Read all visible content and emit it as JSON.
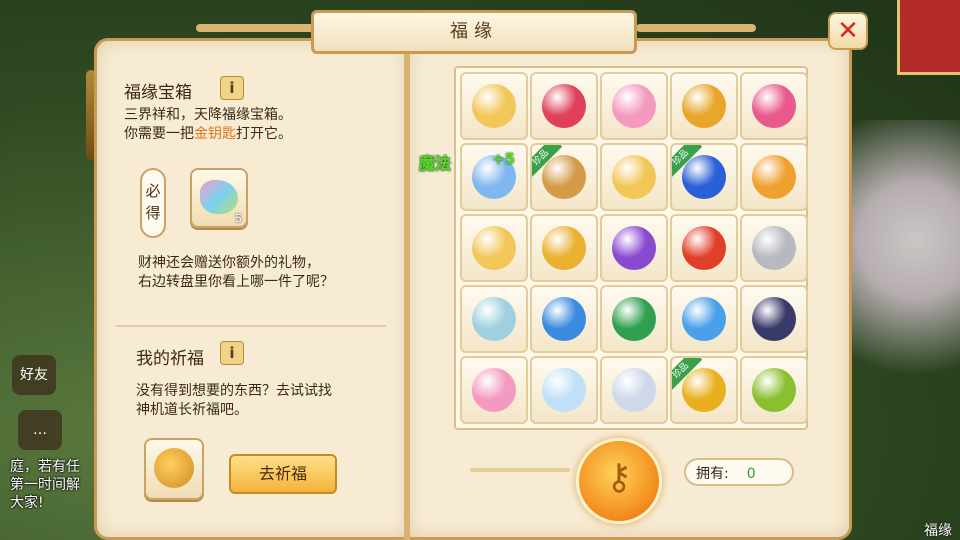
{
  "window": {
    "title": "福缘"
  },
  "left": {
    "chest_title": "福缘宝箱",
    "info_symbol": "i",
    "chest_desc_1": "三界祥和，天降福缘宝箱。",
    "chest_desc_2a": "你需要一把",
    "chest_desc_2b": "金钥匙",
    "chest_desc_2c": "打开它。",
    "must_label": "必得",
    "must_item_count": "5",
    "extra_desc_1": "财神还会赠送你额外的礼物，",
    "extra_desc_2": "右边转盘里你看上哪一件了呢？",
    "pray_title": "我的祈福",
    "pray_desc_1": "没有得到想要的东西？去试试找",
    "pray_desc_2": "神机道长祈福吧。",
    "pray_button": "去祈福"
  },
  "grid": {
    "rare_badge": "珍品",
    "magic_label": "魔法",
    "magic_bonus": "+5",
    "items": [
      {
        "name": "cheese-icon",
        "color": "#f2c75a"
      },
      {
        "name": "red-orb-icon",
        "color": "#e0405a"
      },
      {
        "name": "pink-pet-icon",
        "color": "#f49ac0"
      },
      {
        "name": "gold-coin-icon",
        "color": "#e8a62a"
      },
      {
        "name": "pink-orb-icon",
        "color": "#e85a8a"
      },
      {
        "name": "magic-orb-icon",
        "color": "#7fb8f0"
      },
      {
        "name": "scroll-icon",
        "color": "#d49a48"
      },
      {
        "name": "cheese-icon",
        "color": "#f2c75a"
      },
      {
        "name": "blue-orb-icon",
        "color": "#2a5fd6"
      },
      {
        "name": "fire-emblem-icon",
        "color": "#f0a030"
      },
      {
        "name": "cheese-icon",
        "color": "#f2c75a"
      },
      {
        "name": "gold-gem-icon",
        "color": "#eab030"
      },
      {
        "name": "purple-crystal-icon",
        "color": "#8a4ad0"
      },
      {
        "name": "lucky-bag-icon",
        "color": "#e0402a"
      },
      {
        "name": "silver-crystal-icon",
        "color": "#b8b8c0"
      },
      {
        "name": "rainbow-horse-icon",
        "color": "#9fd0e0"
      },
      {
        "name": "blue-crystal-icon",
        "color": "#3a8ae0"
      },
      {
        "name": "green-orb-icon",
        "color": "#30a050"
      },
      {
        "name": "moon-gem-icon",
        "color": "#4aa0e8"
      },
      {
        "name": "dark-dragon-icon",
        "color": "#3a3a6a"
      },
      {
        "name": "pink-pet-icon",
        "color": "#f49ac0"
      },
      {
        "name": "ice-cat-icon",
        "color": "#bfe0f8"
      },
      {
        "name": "egg-icon",
        "color": "#cfd8e8"
      },
      {
        "name": "amber-crystal-icon",
        "color": "#e8b020"
      },
      {
        "name": "green-beans-icon",
        "color": "#8ac030"
      }
    ],
    "rare_indices": [
      6,
      8,
      23
    ]
  },
  "bottom": {
    "owned_label": "拥有:",
    "owned_value": "0"
  },
  "background": {
    "chat_friends": "好友",
    "chat_line_1": "庭，若有任",
    "chat_line_2": "第一时间解",
    "chat_line_3": "大家!",
    "corner_text": "福缘"
  }
}
